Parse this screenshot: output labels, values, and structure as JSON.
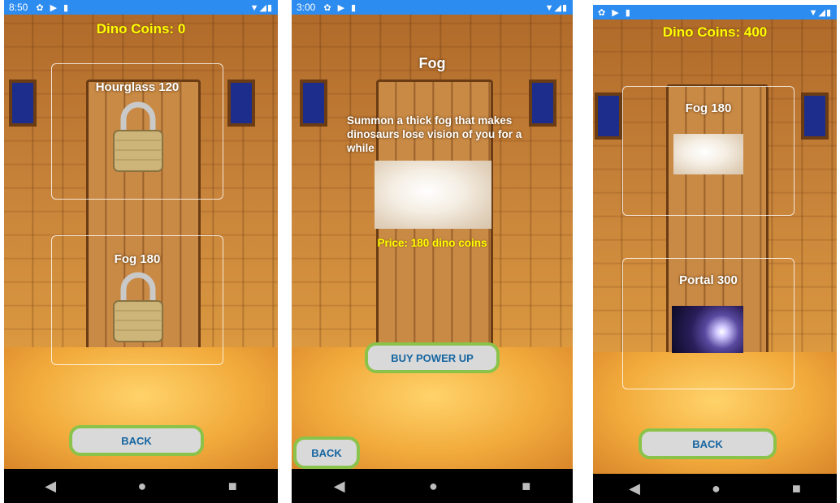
{
  "screen1": {
    "status": {
      "time": "8:50",
      "icons_left": [
        "settings-icon",
        "play-protect-icon",
        "sd-card-icon"
      ],
      "icons_right": [
        "wifi-icon",
        "signal-icon",
        "battery-icon"
      ]
    },
    "coins": "Dino Coins: 0",
    "cards": [
      {
        "label": "Hourglass 120",
        "locked": true
      },
      {
        "label": "Fog 180",
        "locked": true
      }
    ],
    "back_label": "BACK"
  },
  "screen2": {
    "status": {
      "time": "3:00",
      "icons_left": [
        "settings-icon",
        "play-protect-icon",
        "sd-card-icon"
      ],
      "icons_right": [
        "wifi-icon",
        "signal-icon",
        "battery-icon"
      ]
    },
    "title": "Fog",
    "description": "Summon a thick fog that makes dinosaurs lose vision of you for a while",
    "price": "Price: 180 dino coins",
    "buy_label": "BUY POWER UP",
    "back_label": "BACK"
  },
  "screen3": {
    "status": {
      "icons_left": [
        "settings-icon",
        "play-protect-icon",
        "sd-card-icon"
      ],
      "icons_right": [
        "wifi-icon",
        "signal-icon",
        "battery-icon"
      ]
    },
    "coins": "Dino Coins: 400",
    "cards": [
      {
        "label": "Fog 180",
        "image": "fog-image"
      },
      {
        "label": "Portal 300",
        "image": "portal-image"
      }
    ],
    "back_label": "BACK"
  },
  "navbar": {
    "back": "◀",
    "home": "●",
    "recents": "■"
  }
}
